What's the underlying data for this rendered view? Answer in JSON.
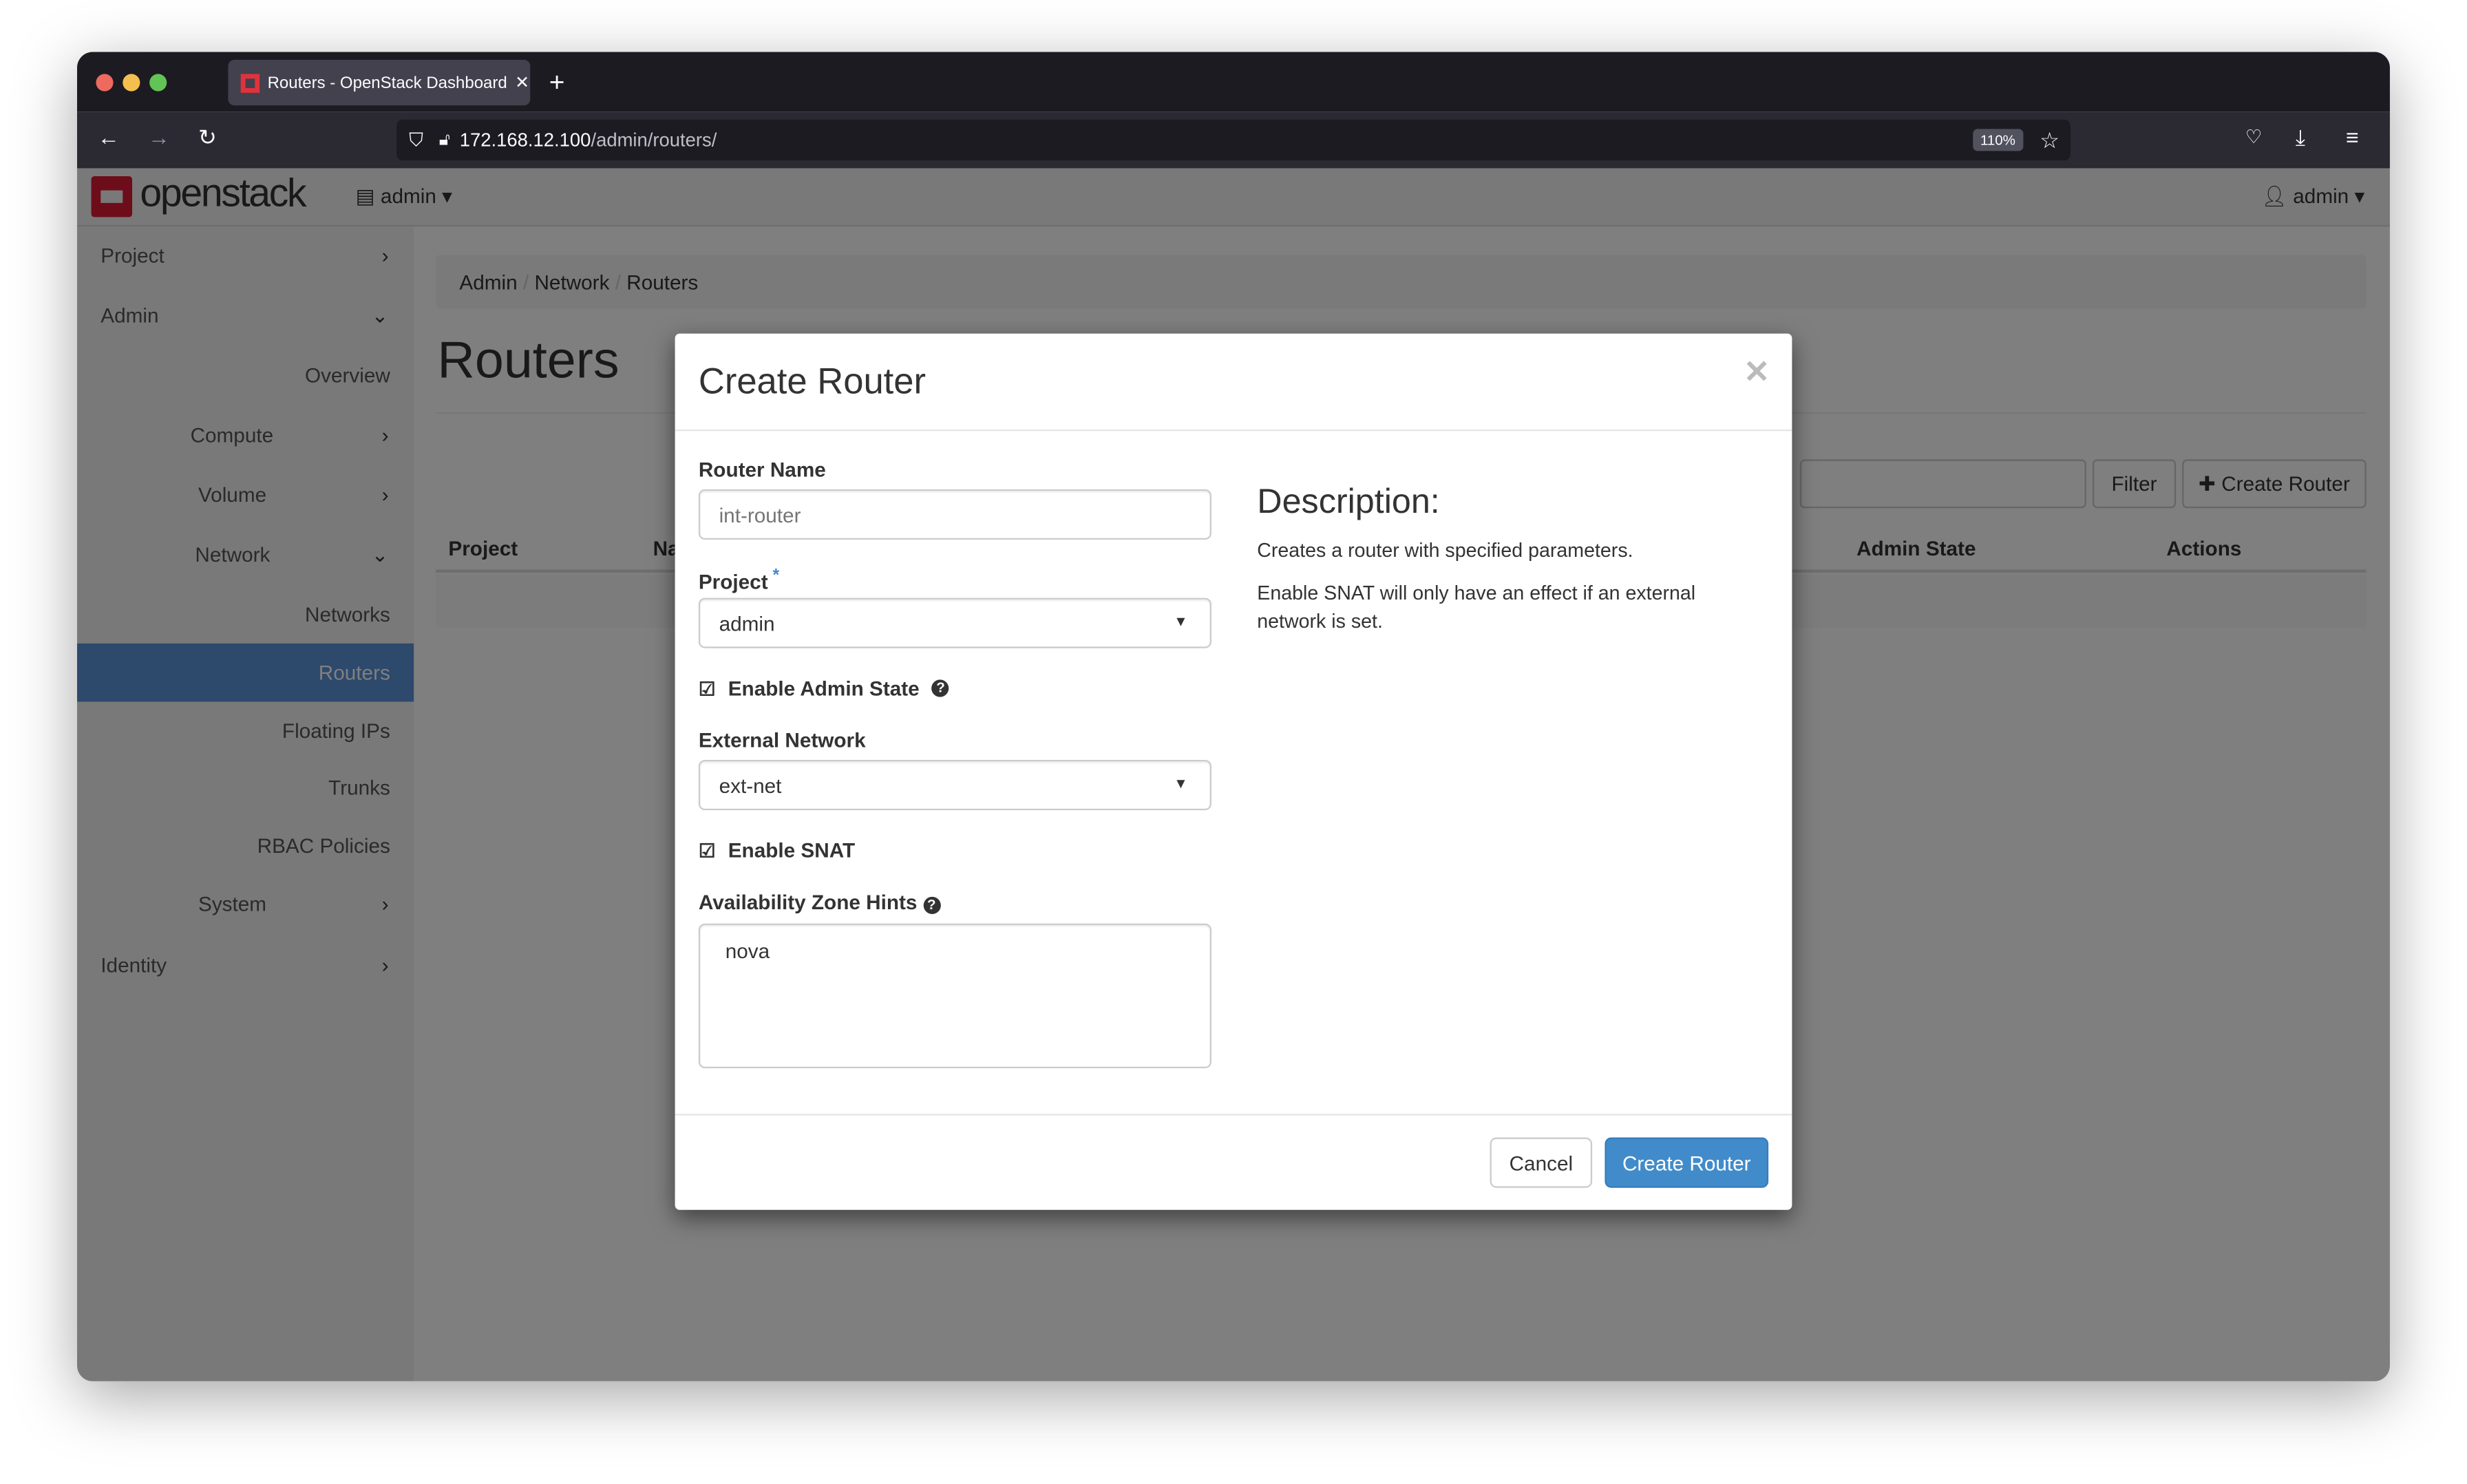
{
  "browser": {
    "tab_title": "Routers - OpenStack Dashboard",
    "url_host": "172.168.12.100",
    "url_path": "/admin/routers/",
    "zoom": "110%"
  },
  "header": {
    "logo": "openstack",
    "project_selector": "admin",
    "user_menu": "admin"
  },
  "sidebar": {
    "items": [
      {
        "label": "Project"
      },
      {
        "label": "Admin"
      },
      {
        "label": "Overview"
      },
      {
        "label": "Compute"
      },
      {
        "label": "Volume"
      },
      {
        "label": "Network"
      },
      {
        "label": "Networks"
      },
      {
        "label": "Routers",
        "active": true
      },
      {
        "label": "Floating IPs"
      },
      {
        "label": "Trunks"
      },
      {
        "label": "RBAC Policies"
      },
      {
        "label": "System"
      },
      {
        "label": "Identity"
      }
    ]
  },
  "main": {
    "breadcrumb": [
      "Admin",
      "Network",
      "Routers"
    ],
    "title": "Routers",
    "filter_button": "Filter",
    "create_button": "Create Router",
    "columns": [
      "Project",
      "Name",
      "Admin State",
      "Actions"
    ]
  },
  "modal": {
    "title": "Create Router",
    "router_name_label": "Router Name",
    "router_name_placeholder": "int-router",
    "project_label": "Project",
    "required_mark": "*",
    "project_value": "admin",
    "admin_state_label": "Enable Admin State",
    "admin_state_checked": true,
    "external_network_label": "External Network",
    "external_network_value": "ext-net",
    "snat_label": "Enable SNAT",
    "snat_checked": true,
    "az_hints_label": "Availability Zone Hints",
    "az_hints_options": [
      "nova"
    ],
    "description_title": "Description:",
    "description_lines": [
      "Creates a router with specified parameters.",
      "Enable SNAT will only have an effect if an external network is set."
    ],
    "cancel": "Cancel",
    "submit": "Create Router"
  },
  "colors": {
    "accent": "#428bca",
    "active_nav": "#3b6aa6",
    "logo_red": "#da1a32"
  }
}
